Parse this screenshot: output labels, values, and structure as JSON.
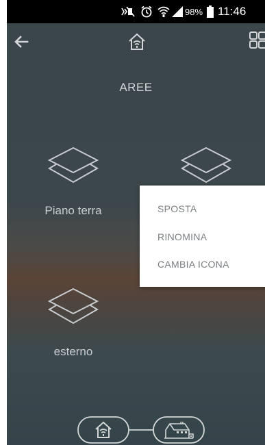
{
  "status_bar": {
    "battery_percent": "98%",
    "time": "11:46"
  },
  "header": {
    "title": "AREE"
  },
  "areas": [
    {
      "label": "Piano terra"
    },
    {
      "label": ""
    },
    {
      "label": "esterno"
    }
  ],
  "context_menu": {
    "items": [
      {
        "label": "SPOSTA"
      },
      {
        "label": "RINOMINA"
      },
      {
        "label": "CAMBIA ICONA"
      }
    ]
  },
  "icons": [
    "back-arrow-icon",
    "home-wifi-icon",
    "grid-icon",
    "layers-icon",
    "house-icon"
  ],
  "colors": {
    "background": "#3c474b",
    "text_light": "#d4d7d8",
    "menu_text": "#7a7f82",
    "menu_bg": "#ffffff"
  }
}
